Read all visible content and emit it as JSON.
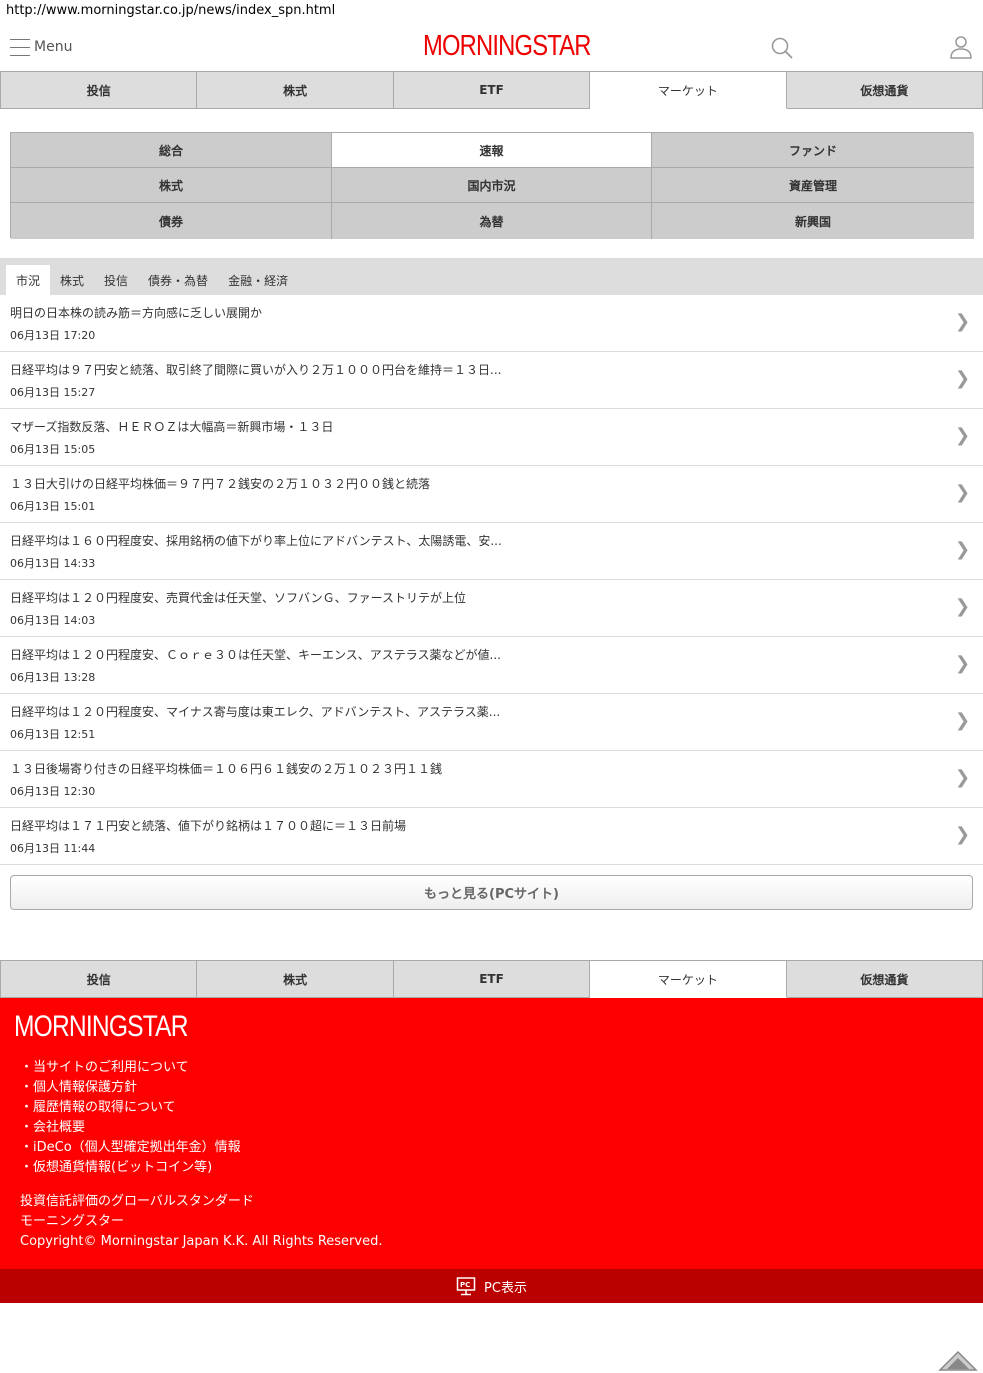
{
  "url": "http://www.morningstar.co.jp/news/index_spn.html",
  "header": {
    "menu_label": "Menu",
    "logo_text": "MORNINGSTAR",
    "brand_color": "#ee0000"
  },
  "main_tabs": [
    {
      "label": "投信",
      "active": false
    },
    {
      "label": "株式",
      "active": false
    },
    {
      "label": "ETF",
      "active": false
    },
    {
      "label": "マーケット",
      "active": true
    },
    {
      "label": "仮想通貨",
      "active": false
    }
  ],
  "sub_categories": [
    {
      "label": "総合",
      "active": false
    },
    {
      "label": "速報",
      "active": true
    },
    {
      "label": "ファンド",
      "active": false
    },
    {
      "label": "株式",
      "active": false
    },
    {
      "label": "国内市況",
      "active": false
    },
    {
      "label": "資産管理",
      "active": false
    },
    {
      "label": "債券",
      "active": false
    },
    {
      "label": "為替",
      "active": false
    },
    {
      "label": "新興国",
      "active": false
    }
  ],
  "news_tabs": [
    {
      "label": "市況",
      "active": true
    },
    {
      "label": "株式",
      "active": false
    },
    {
      "label": "投信",
      "active": false
    },
    {
      "label": "債券・為替",
      "active": false
    },
    {
      "label": "金融・経済",
      "active": false
    }
  ],
  "news": [
    {
      "title": "明日の日本株の読み筋＝方向感に乏しい展開か",
      "date": "06月13日 17:20"
    },
    {
      "title": "日経平均は９７円安と続落、取引終了間際に買いが入り２万１０００円台を維持＝１３日...",
      "date": "06月13日 15:27"
    },
    {
      "title": "マザーズ指数反落、ＨＥＲＯＺは大幅高＝新興市場・１３日",
      "date": "06月13日 15:05"
    },
    {
      "title": "１３日大引けの日経平均株価＝９７円７２銭安の２万１０３２円００銭と続落",
      "date": "06月13日 15:01"
    },
    {
      "title": "日経平均は１６０円程度安、採用銘柄の値下がり率上位にアドバンテスト、太陽誘電、安...",
      "date": "06月13日 14:33"
    },
    {
      "title": "日経平均は１２０円程度安、売買代金は任天堂、ソフバンＧ、ファーストリテが上位",
      "date": "06月13日 14:03"
    },
    {
      "title": "日経平均は１２０円程度安、Ｃｏｒｅ３０は任天堂、キーエンス、アステラス薬などが値...",
      "date": "06月13日 13:28"
    },
    {
      "title": "日経平均は１２０円程度安、マイナス寄与度は東エレク、アドバンテスト、アステラス薬...",
      "date": "06月13日 12:51"
    },
    {
      "title": "１３日後場寄り付きの日経平均株価＝１０６円６１銭安の２万１０２３円１１銭",
      "date": "06月13日 12:30"
    },
    {
      "title": "日経平均は１７１円安と続落、値下がり銘柄は１７００超に＝１３日前場",
      "date": "06月13日 11:44"
    }
  ],
  "arrow_glyph": "❯",
  "more_button": "もっと見る(PCサイト)",
  "footer": {
    "logo_text": "MORNINGSTAR",
    "links": [
      "・当サイトのご利用について",
      "・個人情報保護方針",
      "・履歴情報の取得について",
      "・会社概要",
      "・iDeCo（個人型確定拠出年金）情報",
      "・仮想通貨情報(ビットコイン等)"
    ],
    "tagline_1": "投資信託評価のグローバルスタンダード",
    "tagline_2": "モーニングスター",
    "copyright": "Copyright© Morningstar Japan K.K. All Rights Reserved.",
    "pc_view": "PC表示",
    "bg_color": "#ff0000"
  },
  "icons": {
    "menu": "hamburger-icon",
    "search": "search-icon",
    "user": "user-icon",
    "pc": "pc-monitor-icon",
    "page_top": "page-top-arrow-icon"
  }
}
